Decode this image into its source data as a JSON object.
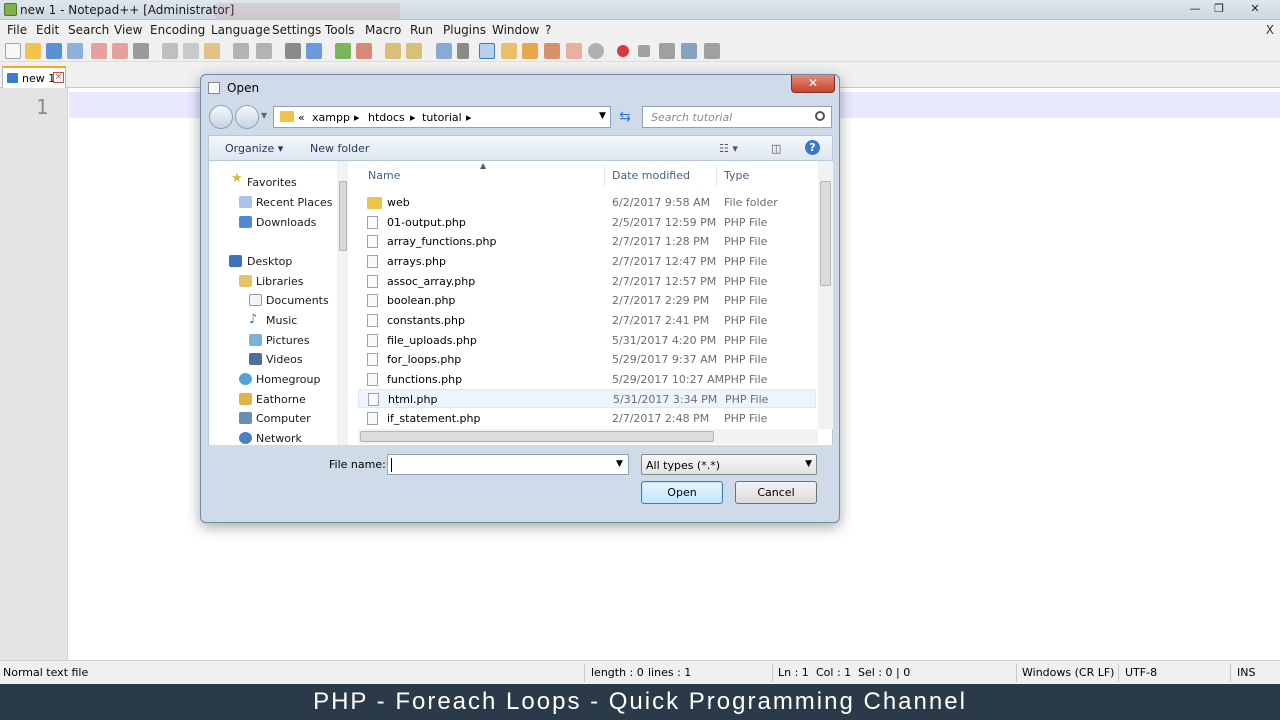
{
  "window": {
    "title": "new 1 - Notepad++ [Administrator]",
    "minimize": "—",
    "restore": "❐",
    "close": "✕"
  },
  "menu": {
    "items": [
      "File",
      "Edit",
      "Search",
      "View",
      "Encoding",
      "Language",
      "Settings",
      "Tools",
      "Macro",
      "Run",
      "Plugins",
      "Window",
      "?"
    ],
    "close": "X"
  },
  "tabs": [
    {
      "label": "new 1"
    }
  ],
  "editor": {
    "line_number": "1"
  },
  "dialog": {
    "title": "Open",
    "close": "✕",
    "address": {
      "prefix": "«",
      "crumbs": [
        "xampp",
        "htdocs",
        "tutorial"
      ]
    },
    "search_placeholder": "Search tutorial",
    "commands": {
      "organize": "Organize",
      "new_folder": "New folder"
    },
    "nav": {
      "favorites": "Favorites",
      "recent_places": "Recent Places",
      "downloads": "Downloads",
      "desktop": "Desktop",
      "libraries": "Libraries",
      "documents": "Documents",
      "music": "Music",
      "pictures": "Pictures",
      "videos": "Videos",
      "homegroup": "Homegroup",
      "eathorne": "Eathorne",
      "computer": "Computer",
      "network": "Network"
    },
    "columns": {
      "name": "Name",
      "date": "Date modified",
      "type": "Type"
    },
    "files": [
      {
        "name": "web",
        "date": "6/2/2017 9:58 AM",
        "type": "File folder"
      },
      {
        "name": "01-output.php",
        "date": "2/5/2017 12:59 PM",
        "type": "PHP File"
      },
      {
        "name": "array_functions.php",
        "date": "2/7/2017 1:28 PM",
        "type": "PHP File"
      },
      {
        "name": "arrays.php",
        "date": "2/7/2017 12:47 PM",
        "type": "PHP File"
      },
      {
        "name": "assoc_array.php",
        "date": "2/7/2017 12:57 PM",
        "type": "PHP File"
      },
      {
        "name": "boolean.php",
        "date": "2/7/2017 2:29 PM",
        "type": "PHP File"
      },
      {
        "name": "constants.php",
        "date": "2/7/2017 2:41 PM",
        "type": "PHP File"
      },
      {
        "name": "file_uploads.php",
        "date": "5/31/2017 4:20 PM",
        "type": "PHP File"
      },
      {
        "name": "for_loops.php",
        "date": "5/29/2017 9:37 AM",
        "type": "PHP File"
      },
      {
        "name": "functions.php",
        "date": "5/29/2017 10:27 AM",
        "type": "PHP File"
      },
      {
        "name": "html.php",
        "date": "5/31/2017 3:34 PM",
        "type": "PHP File"
      },
      {
        "name": "if_statement.php",
        "date": "2/7/2017 2:48 PM",
        "type": "PHP File"
      }
    ],
    "file_name_label": "File name:",
    "file_name_value": "",
    "file_type": "All types (*.*)",
    "open_button": "Open",
    "cancel_button": "Cancel"
  },
  "status": {
    "file_type": "Normal text file",
    "length": "length : 0",
    "lines": "lines : 1",
    "ln": "Ln : 1",
    "col": "Col : 1",
    "sel": "Sel : 0 | 0",
    "eol": "Windows (CR LF)",
    "encoding": "UTF-8",
    "mode": "INS"
  },
  "caption": "PHP - Foreach Loops - Quick Programming Channel",
  "colors": {
    "accent": "#3c7fb1",
    "caption_bg": "#2b3a48",
    "folder": "#f0c34a"
  }
}
